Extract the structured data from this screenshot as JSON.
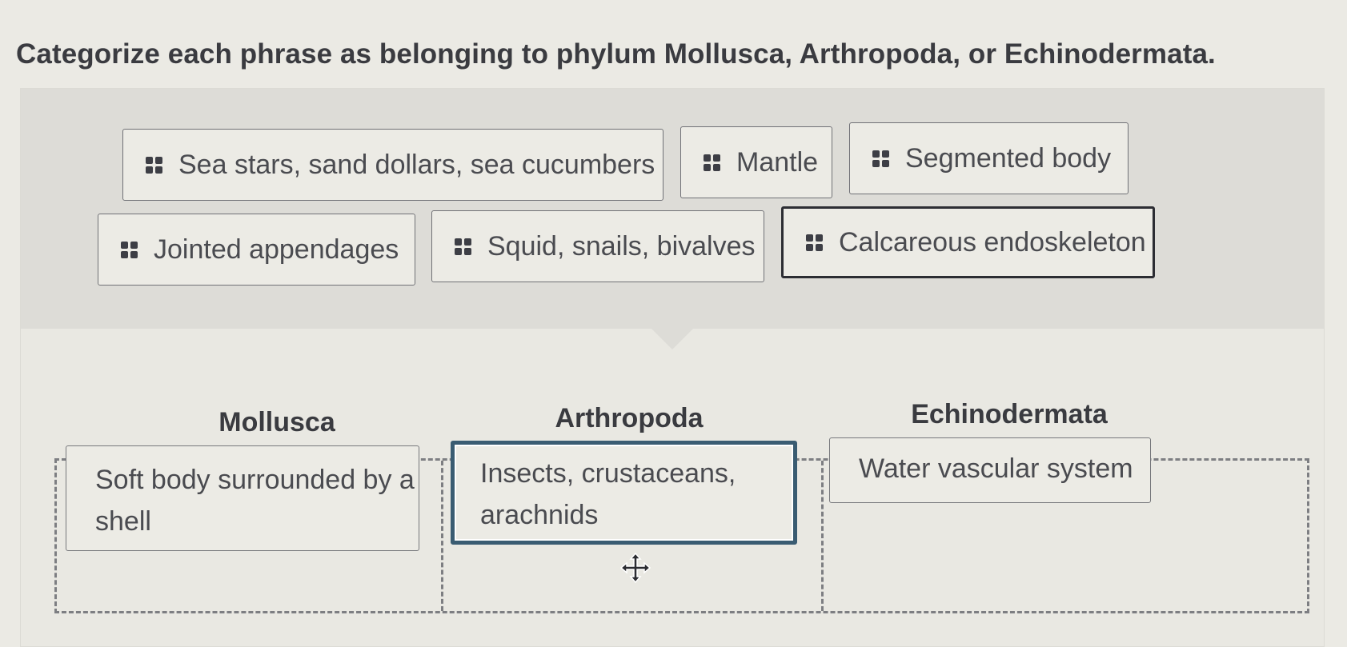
{
  "question": "Categorize each phrase as belonging to phylum Mollusca, Arthropoda, or Echinodermata.",
  "colors": {
    "selected_border": "#2c2d33",
    "active_drop_border": "#3a5c72",
    "grip": "#3d3e45"
  },
  "source_bank": {
    "chips": [
      {
        "label": "Sea stars, sand dollars, sea cucumbers",
        "selected": false
      },
      {
        "label": "Mantle",
        "selected": false
      },
      {
        "label": "Segmented body",
        "selected": false
      },
      {
        "label": "Jointed appendages",
        "selected": false
      },
      {
        "label": "Squid, snails, bivalves",
        "selected": false
      },
      {
        "label": "Calcareous endoskeleton",
        "selected": true
      }
    ]
  },
  "categories": [
    {
      "label": "Mollusca",
      "items": [
        "Soft body surrounded by a shell"
      ]
    },
    {
      "label": "Arthropoda",
      "items": [
        "Insects, crustaceans, arachnids"
      ]
    },
    {
      "label": "Echinodermata",
      "items": [
        "Water vascular system"
      ]
    }
  ],
  "cursor": "move-cursor"
}
